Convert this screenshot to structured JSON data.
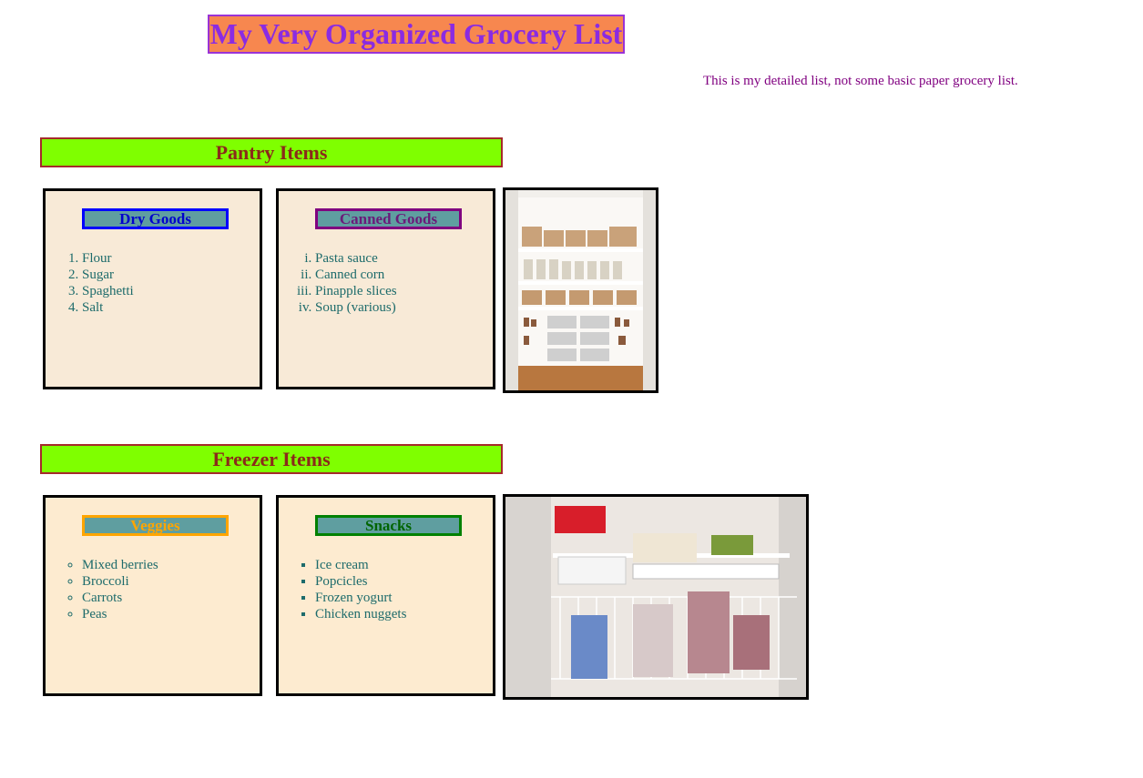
{
  "title": "My Very Organized Grocery List",
  "subtitle": "This is my detailed list, not some basic paper grocery list.",
  "pantry": {
    "header": "Pantry Items",
    "dry_goods": {
      "heading": "Dry Goods",
      "items": [
        "Flour",
        "Sugar",
        "Spaghetti",
        "Salt"
      ]
    },
    "canned_goods": {
      "heading": "Canned Goods",
      "items": [
        "Pasta sauce",
        "Canned corn",
        "Pinapple slices",
        "Soup (various)"
      ]
    }
  },
  "freezer": {
    "header": "Freezer Items",
    "veggies": {
      "heading": "Veggies",
      "items": [
        "Mixed berries",
        "Broccoli",
        "Carrots",
        "Peas"
      ]
    },
    "snacks": {
      "heading": "Snacks",
      "items": [
        "Ice cream",
        "Popcicles",
        "Frozen yogurt",
        "Chicken nuggets"
      ]
    }
  },
  "images": {
    "pantry_photo": "pantry-photo",
    "freezer_photo": "freezer-photo"
  },
  "colors": {
    "title_bg": "#f7874f",
    "title_text": "#8a2be2",
    "section_bg": "#7fff00",
    "section_text": "#8b2a1a",
    "category_bg": "#5f9ea0",
    "list_text": "#1d6b6b"
  }
}
